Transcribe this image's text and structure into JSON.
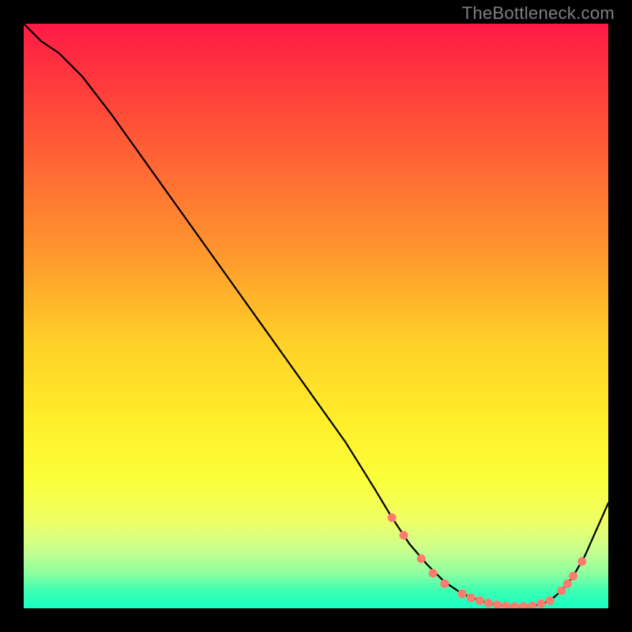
{
  "watermark": "TheBottleneck.com",
  "chart_data": {
    "type": "line",
    "title": "",
    "xlabel": "",
    "ylabel": "",
    "xlim": [
      0,
      100
    ],
    "ylim": [
      0,
      100
    ],
    "grid": false,
    "legend": false,
    "series": [
      {
        "name": "curve",
        "color": "#000000",
        "x": [
          0,
          3,
          6,
          10,
          15,
          20,
          25,
          30,
          35,
          40,
          45,
          50,
          55,
          60,
          63,
          66,
          69,
          72,
          75,
          78,
          81,
          84,
          86,
          88,
          90,
          92,
          94,
          96,
          100
        ],
        "y": [
          100,
          97,
          95,
          91,
          84.5,
          77.5,
          70.5,
          63.5,
          56.5,
          49.5,
          42.5,
          35.5,
          28.5,
          20.5,
          15.5,
          11,
          7.5,
          4.5,
          2.5,
          1.3,
          0.6,
          0.3,
          0.3,
          0.6,
          1.3,
          3,
          5.5,
          9,
          18
        ]
      }
    ],
    "markers": {
      "color": "#ff7b6e",
      "radius_px": 5.5,
      "points": [
        {
          "x": 63,
          "y": 15.5
        },
        {
          "x": 65,
          "y": 12.5
        },
        {
          "x": 68,
          "y": 8.5
        },
        {
          "x": 70,
          "y": 6
        },
        {
          "x": 72,
          "y": 4.2
        },
        {
          "x": 75,
          "y": 2.5
        },
        {
          "x": 76.5,
          "y": 1.8
        },
        {
          "x": 78,
          "y": 1.3
        },
        {
          "x": 79.5,
          "y": 0.9
        },
        {
          "x": 81,
          "y": 0.6
        },
        {
          "x": 82.5,
          "y": 0.4
        },
        {
          "x": 84,
          "y": 0.3
        },
        {
          "x": 85.5,
          "y": 0.3
        },
        {
          "x": 87,
          "y": 0.4
        },
        {
          "x": 88.5,
          "y": 0.8
        },
        {
          "x": 90,
          "y": 1.3
        },
        {
          "x": 92,
          "y": 3
        },
        {
          "x": 93,
          "y": 4.2
        },
        {
          "x": 94,
          "y": 5.5
        },
        {
          "x": 95.5,
          "y": 8
        }
      ]
    }
  }
}
